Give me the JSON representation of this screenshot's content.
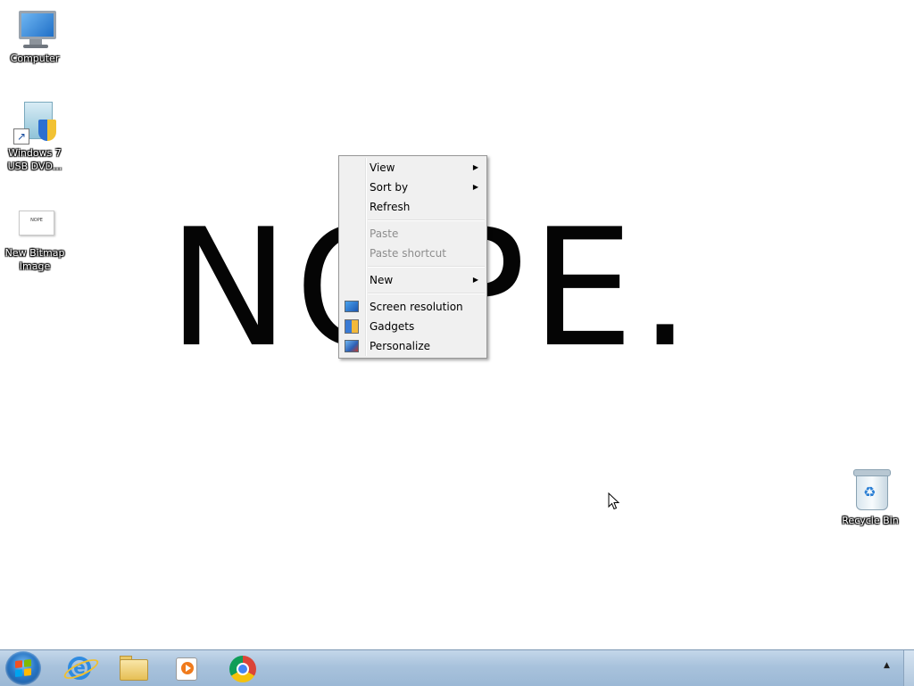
{
  "desktop": {
    "wallpaper_text": "NOPE.",
    "icons": [
      {
        "label_lines": [
          "Computer"
        ],
        "icon": "computer-icon"
      },
      {
        "label_lines": [
          "Windows 7",
          "USB DVD..."
        ],
        "icon": "windows-usb-tool-icon"
      },
      {
        "label_lines": [
          "New Bitmap",
          "Image"
        ],
        "icon": "bitmap-image-icon",
        "thumb_text": "NOPE"
      },
      {
        "label_lines": [
          "Recycle Bin"
        ],
        "icon": "recycle-bin-icon"
      }
    ]
  },
  "context_menu": {
    "items": [
      {
        "label": "View",
        "submenu": true,
        "enabled": true
      },
      {
        "label": "Sort by",
        "submenu": true,
        "enabled": true
      },
      {
        "label": "Refresh",
        "submenu": false,
        "enabled": true
      },
      {
        "label": "Paste",
        "submenu": false,
        "enabled": false
      },
      {
        "label": "Paste shortcut",
        "submenu": false,
        "enabled": false
      },
      {
        "label": "New",
        "submenu": true,
        "enabled": true
      },
      {
        "label": "Screen resolution",
        "icon": "screen-resolution-icon",
        "enabled": true
      },
      {
        "label": "Gadgets",
        "icon": "gadgets-icon",
        "enabled": true
      },
      {
        "label": "Personalize",
        "icon": "personalize-icon",
        "enabled": true
      }
    ],
    "submenu_arrow": "▶"
  },
  "taskbar": {
    "pinned": [
      {
        "name": "start-button",
        "icon": "windows-logo-icon"
      },
      {
        "name": "internet-explorer",
        "icon": "internet-explorer-icon"
      },
      {
        "name": "windows-explorer",
        "icon": "folder-icon"
      },
      {
        "name": "windows-media-player",
        "icon": "media-player-icon"
      },
      {
        "name": "google-chrome",
        "icon": "chrome-icon"
      }
    ],
    "tray_arrow": "▲",
    "colors": {
      "flag_red": "#f25022",
      "flag_green": "#7fba00",
      "flag_blue": "#00a4ef",
      "flag_yellow": "#ffb900"
    }
  }
}
